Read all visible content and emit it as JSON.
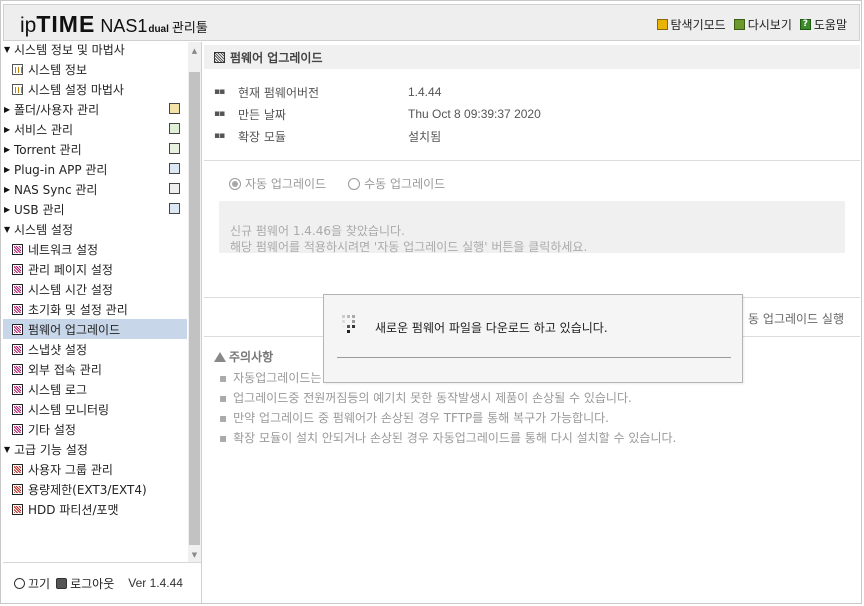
{
  "header": {
    "logo_ip": "ip",
    "logo_time": "TIME",
    "logo_nas": "NAS1",
    "logo_dual": "dual",
    "logo_admin": "관리툴",
    "links": [
      {
        "label": "탐색기모드",
        "icon": "explorer-icon"
      },
      {
        "label": "다시보기",
        "icon": "refresh-icon"
      },
      {
        "label": "도움말",
        "icon": "help-icon"
      }
    ]
  },
  "sidebar": {
    "groups": {
      "sysinfo": "시스템 정보 및 마법사",
      "folders": "폴더/사용자 관리",
      "services": "서비스 관리",
      "torrent": "Torrent 관리",
      "plugin": "Plug-in APP 관리",
      "nassync": "NAS Sync 관리",
      "usb": "USB 관리",
      "settings": "시스템 설정",
      "advanced": "고급 기능 설정"
    },
    "items": {
      "sysinfo_info": "시스템 정보",
      "sysinfo_wizard": "시스템 설정 마법사",
      "network": "네트워크 설정",
      "adminpage": "관리 페이지 설정",
      "time": "시스템 시간 설정",
      "reset": "초기화 및 설정 관리",
      "firmware": "펌웨어 업그레이드",
      "snapshot": "스냅샷 설정",
      "remote": "외부 접속 관리",
      "log": "시스템 로그",
      "monitor": "시스템 모니터링",
      "etc": "기타 설정",
      "usergroup": "사용자 그룹 관리",
      "quota": "용량제한(EXT3/EXT4)",
      "hdd": "HDD 파티션/포맷"
    },
    "footer": {
      "power": "끄기",
      "logout": "로그아웃",
      "version": "Ver 1.4.44"
    }
  },
  "main": {
    "title": "펌웨어 업그레이드",
    "info": [
      {
        "label": "현재 펌웨어버전",
        "value": "1.4.44"
      },
      {
        "label": "만든 날짜",
        "value": "Thu Oct 8 09:39:37 2020"
      },
      {
        "label": "확장 모듈",
        "value": "설치됨"
      }
    ],
    "radio_auto": "자동 업그레이드",
    "radio_manual": "수동 업그레이드",
    "message_line1": "신규 펌웨어 1.4.46을 찾았습니다.",
    "message_line2": "해당 펌웨어를 적용하시려면 '자동 업그레이드 실행' 버튼을 클릭하세요.",
    "run_button": "동 업그레이드 실행",
    "notes_title": "주의사항",
    "notes": [
      "자동업그레이드는",
      "업그레이드중 전원꺼짐등의 예기치 못한 동작발생시 제품이 손상될 수 있습니다.",
      "만약 업그레이드 중 펌웨어가 손상된 경우 TFTP를 통해 복구가 가능합니다.",
      "확장 모듈이 설치 안되거나 손상된 경우 자동업그레이드를 통해 다시 설치할 수 있습니다."
    ]
  },
  "dialog": {
    "message": "새로운 펌웨어 파일을 다운로드 하고 있습니다."
  }
}
